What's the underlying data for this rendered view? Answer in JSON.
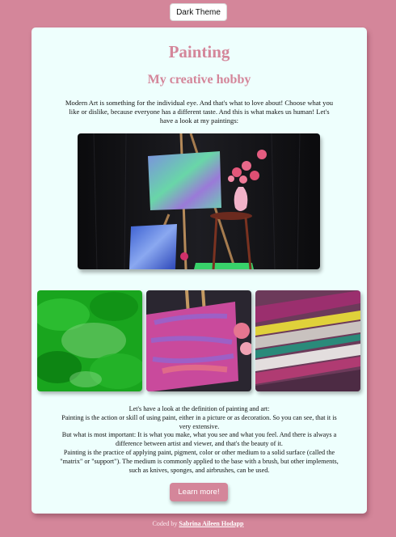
{
  "theme_toggle": {
    "label": "Dark Theme"
  },
  "header": {
    "title": "Painting",
    "subtitle": "My creative hobby"
  },
  "intro": {
    "text": "Modern Art is something for the individual eye. And that's what to love about! Choose what you like or dislike, because everyone has a different taste. And this is what makes us human! Let's have a look at my paintings:"
  },
  "gallery": {
    "hero": {
      "name": "easel-paintings-photo"
    },
    "thumbs": [
      {
        "name": "green-abstract-painting"
      },
      {
        "name": "pink-abstract-painting"
      },
      {
        "name": "multicolor-streaks-painting"
      }
    ]
  },
  "definition": {
    "lines": [
      "Let's have a look at the definition of painting and art:",
      "Painting is the action or skill of using paint, either in a picture or as decoration. So you can see, that it is very extensive.",
      "But what is most important: It is what you make, what you see and what you feel. And there is always a difference between artist and viewer, and that's the beauty of it.",
      "Painting is the practice of applying paint, pigment, color or other medium to a solid surface (called the \"matrix\" or \"support\"). The medium is commonly applied to the base with a brush, but other implements, such as knives, sponges, and airbrushes, can be used."
    ]
  },
  "cta": {
    "label": "Learn more!"
  },
  "footer": {
    "prefix": "Coded by ",
    "author": "Sabrina Aileen Hodapp"
  },
  "colors": {
    "background": "#d4869a",
    "card": "#eefffd",
    "accent": "#d4869a"
  }
}
